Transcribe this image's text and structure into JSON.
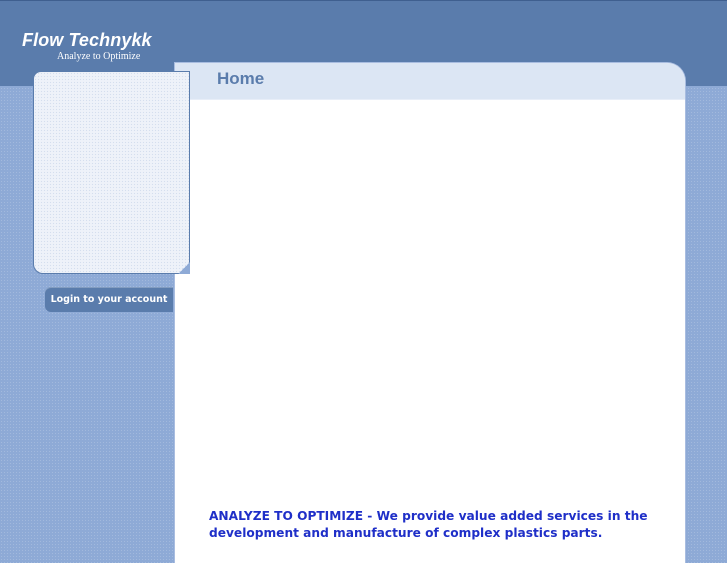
{
  "header": {
    "logo_title": "Flow Technykk",
    "logo_tagline": "Analyze to Optimize"
  },
  "main": {
    "page_title": "Home",
    "intro_text": "ANALYZE TO OPTIMIZE - We provide value added services in the development and manufacture of complex plastics parts."
  },
  "sidebar": {
    "login_label": "Login to your account"
  },
  "colors": {
    "header_bg": "#5a7cac",
    "page_bg": "#8eaad6",
    "title_color": "#5a7cac",
    "intro_text_color": "#1f2fc8"
  }
}
